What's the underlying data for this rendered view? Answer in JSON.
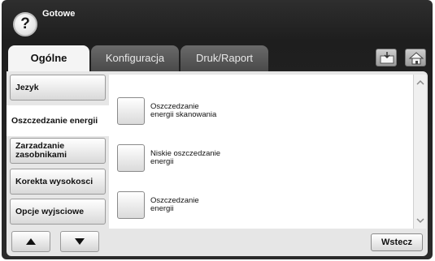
{
  "status": {
    "help_symbol": "?",
    "text": "Gotowe"
  },
  "tabs": [
    {
      "label": "Ogólne"
    },
    {
      "label": "Konfiguracja"
    },
    {
      "label": "Druk/Raport"
    }
  ],
  "toolbar_icons": [
    "job-status-icon",
    "home-icon"
  ],
  "menu": {
    "items": [
      {
        "label": "Jezyk"
      },
      {
        "label": "Oszczedzanie energii"
      },
      {
        "label": "Zarzadzanie zasobnikami"
      },
      {
        "label": "Korekta wysokosci"
      },
      {
        "label": "Opcje wyjsciowe"
      }
    ],
    "selected_index": 1
  },
  "options": [
    {
      "label": "Oszczedzanie energii skanowania"
    },
    {
      "label": "Niskie oszczedzanie energii"
    },
    {
      "label": "Oszczedzanie energii"
    }
  ],
  "footer": {
    "back_label": "Wstecz"
  },
  "colors": {
    "frame": "#2a2a2a",
    "panel": "#e6e6e6",
    "active_tab": "#f4f4f4",
    "inactive_tab": "#5a5a5a"
  }
}
